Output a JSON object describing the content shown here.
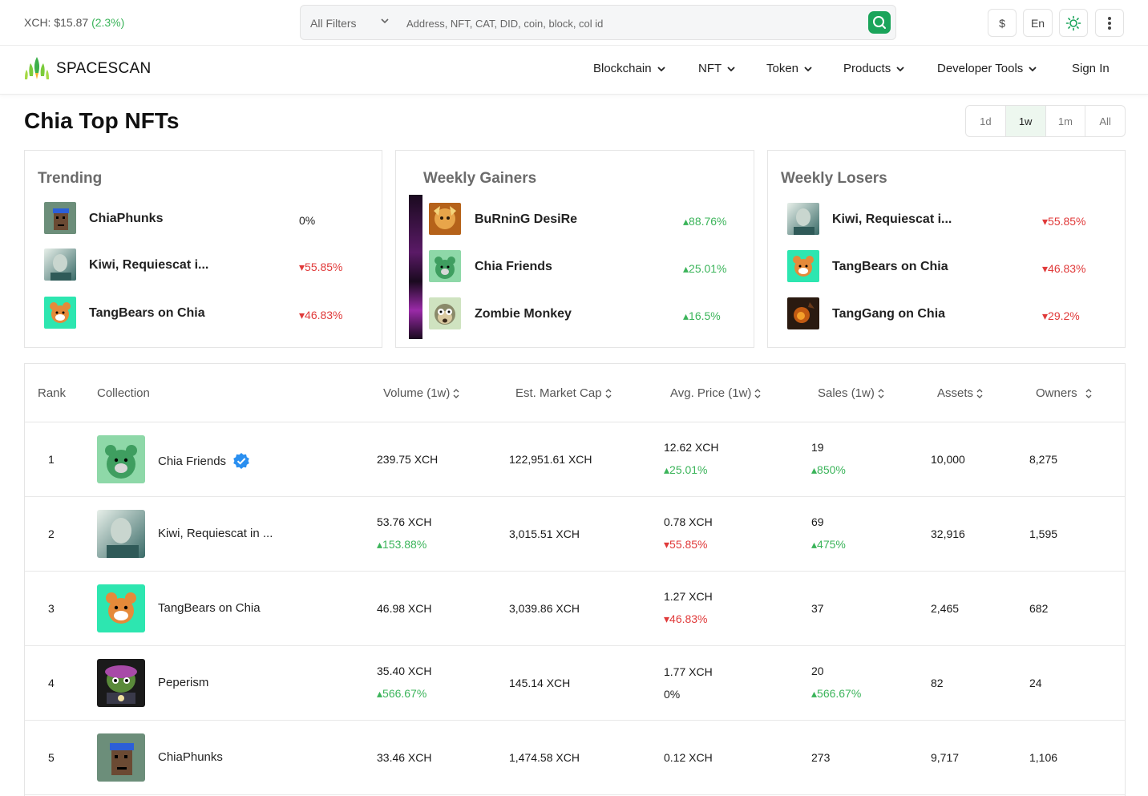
{
  "header": {
    "price_label": "XCH: $15.87",
    "price_change": "(2.3%)",
    "filter_label": "All Filters",
    "search_placeholder": "Address, NFT, CAT, DID, coin, block, col id",
    "currency_button": "$",
    "language_button": "En",
    "theme_icon": "sun-icon",
    "more_icon": "kebab-menu-icon"
  },
  "nav": {
    "brand": "SPACESCAN",
    "items": [
      {
        "label": "Blockchain"
      },
      {
        "label": "NFT"
      },
      {
        "label": "Token"
      },
      {
        "label": "Products"
      },
      {
        "label": "Developer Tools"
      }
    ],
    "sign_in": "Sign In"
  },
  "page": {
    "title": "Chia Top NFTs",
    "ranges": [
      "1d",
      "1w",
      "1m",
      "All"
    ],
    "active_range": "1w"
  },
  "cards": [
    {
      "title": "Trending",
      "rows": [
        {
          "name": "ChiaPhunks",
          "change": "0%",
          "direction": "neutral"
        },
        {
          "name": "Kiwi, Requiescat i...",
          "change": "▾55.85%",
          "direction": "down"
        },
        {
          "name": "TangBears on Chia",
          "change": "▾46.83%",
          "direction": "down"
        }
      ]
    },
    {
      "title": "Weekly Gainers",
      "rows": [
        {
          "name": "BuRninG DesiRe",
          "change": "▴88.76%",
          "direction": "up"
        },
        {
          "name": "Chia Friends",
          "change": "▴25.01%",
          "direction": "up"
        },
        {
          "name": "Zombie Monkey",
          "change": "▴16.5%",
          "direction": "up"
        }
      ]
    },
    {
      "title": "Weekly Losers",
      "rows": [
        {
          "name": "Kiwi, Requiescat i...",
          "change": "▾55.85%",
          "direction": "down"
        },
        {
          "name": "TangBears on Chia",
          "change": "▾46.83%",
          "direction": "down"
        },
        {
          "name": "TangGang on Chia",
          "change": "▾29.2%",
          "direction": "down"
        }
      ]
    }
  ],
  "table": {
    "headers": {
      "rank": "Rank",
      "collection": "Collection",
      "volume": "Volume (1w)",
      "market_cap": "Est. Market Cap",
      "avg_price": "Avg. Price (1w)",
      "sales": "Sales (1w)",
      "assets": "Assets",
      "owners": "Owners"
    },
    "rows": [
      {
        "rank": "1",
        "name": "Chia Friends",
        "verified": true,
        "volume": "239.75 XCH",
        "volume_change": "",
        "market_cap": "122,951.61 XCH",
        "avg_price": "12.62 XCH",
        "avg_price_change": "▴25.01%",
        "sales": "19",
        "sales_change": "▴850%",
        "assets": "10,000",
        "owners": "8,275"
      },
      {
        "rank": "2",
        "name": "Kiwi, Requiescat in ...",
        "verified": false,
        "volume": "53.76 XCH",
        "volume_change": "▴153.88%",
        "market_cap": "3,015.51 XCH",
        "avg_price": "0.78 XCH",
        "avg_price_change": "▾55.85%",
        "sales": "69",
        "sales_change": "▴475%",
        "assets": "32,916",
        "owners": "1,595"
      },
      {
        "rank": "3",
        "name": "TangBears on Chia",
        "verified": false,
        "volume": "46.98 XCH",
        "volume_change": "",
        "market_cap": "3,039.86 XCH",
        "avg_price": "1.27 XCH",
        "avg_price_change": "▾46.83%",
        "sales": "37",
        "sales_change": "",
        "assets": "2,465",
        "owners": "682"
      },
      {
        "rank": "4",
        "name": "Peperism",
        "verified": false,
        "volume": "35.40 XCH",
        "volume_change": "▴566.67%",
        "market_cap": "145.14 XCH",
        "avg_price": "1.77 XCH",
        "avg_price_change": "0%",
        "sales": "20",
        "sales_change": "▴566.67%",
        "assets": "82",
        "owners": "24"
      },
      {
        "rank": "5",
        "name": "ChiaPhunks",
        "verified": false,
        "volume": "33.46 XCH",
        "volume_change": "",
        "market_cap": "1,474.58 XCH",
        "avg_price": "0.12 XCH",
        "avg_price_change": "",
        "sales": "273",
        "sales_change": "",
        "assets": "9,717",
        "owners": "1,106"
      }
    ]
  },
  "colors": {
    "up": "#3bb45a",
    "down": "#e03a3a",
    "accent": "#1aa45a"
  }
}
